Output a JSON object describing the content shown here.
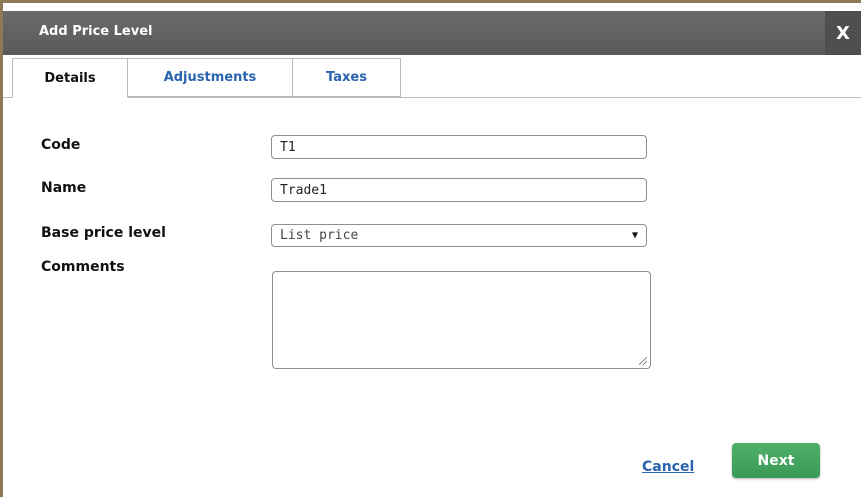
{
  "dialog": {
    "title": "Add Price Level",
    "close_label": "X"
  },
  "tabs": [
    {
      "label": "Details",
      "active": true
    },
    {
      "label": "Adjustments",
      "active": false
    },
    {
      "label": "Taxes",
      "active": false
    }
  ],
  "form": {
    "code": {
      "label": "Code",
      "value": "T1"
    },
    "name": {
      "label": "Name",
      "value": "Trade1"
    },
    "base_price_level": {
      "label": "Base price level",
      "value": "List price"
    },
    "comments": {
      "label": "Comments",
      "value": ""
    }
  },
  "actions": {
    "cancel_label": "Cancel",
    "next_label": "Next"
  },
  "colors": {
    "titlebar": "#5f5f5f",
    "link": "#2a63b0",
    "next_button": "#43a45e"
  }
}
